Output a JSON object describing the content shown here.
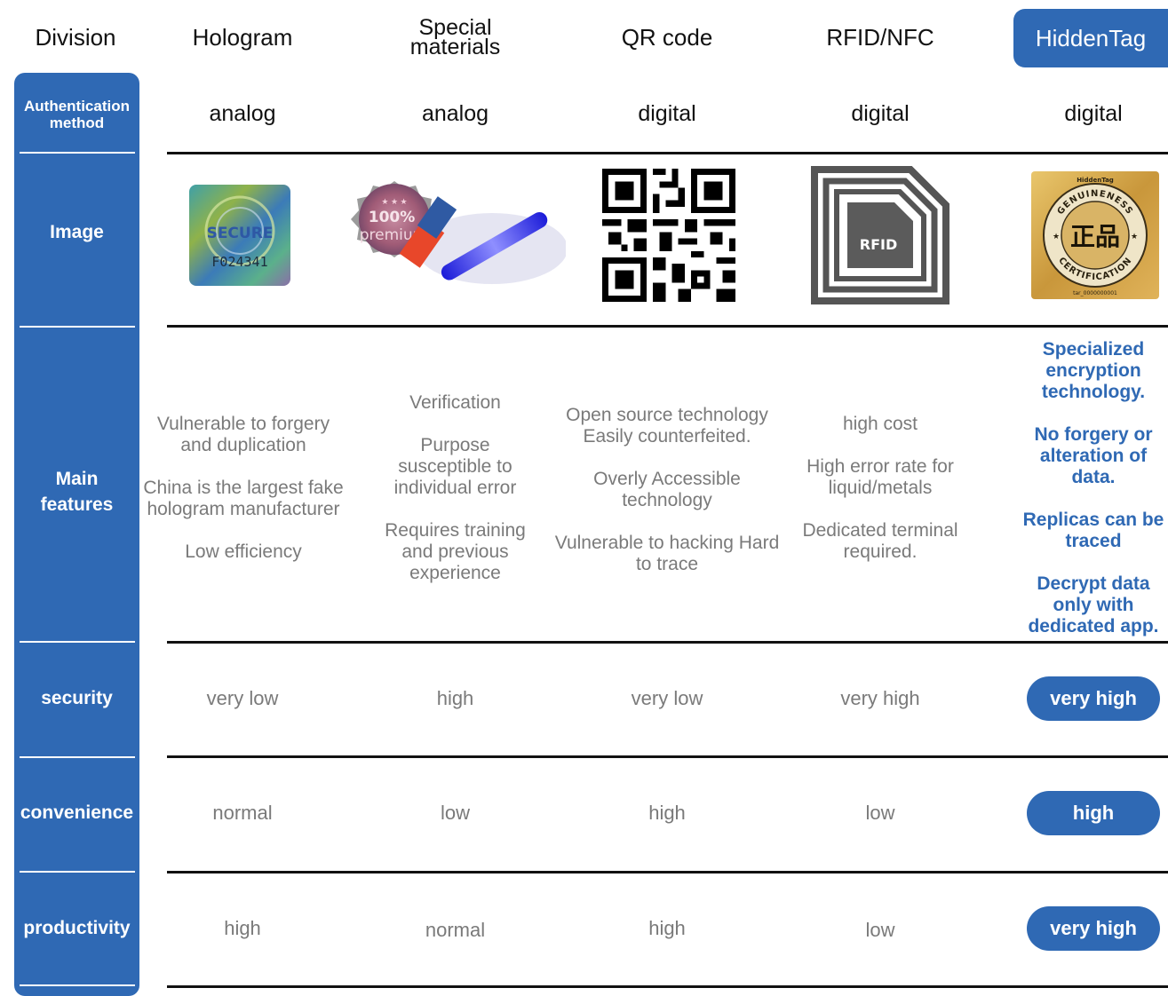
{
  "headers": {
    "division": "Division",
    "hologram": "Hologram",
    "special_line1": "Special",
    "special_line2": "materials",
    "qr": "QR code",
    "rfid": "RFID/NFC",
    "hiddentag": "HiddenTag"
  },
  "rows": {
    "auth_line1": "Authentication",
    "auth_line2": "method",
    "image": "Image",
    "main_line1": "Main",
    "main_line2": "features",
    "security": "security",
    "convenience": "convenience",
    "productivity": "productivity"
  },
  "auth": {
    "hologram": "analog",
    "special": "analog",
    "qr": "digital",
    "rfid": "digital",
    "hiddentag": "digital"
  },
  "images": {
    "hologram_text1": "SECURE",
    "hologram_text2": "F024341",
    "special_text1": "100%",
    "special_text2": "premium",
    "rfid_label": "RFID",
    "hiddentag_brand": "HiddenTag",
    "hiddentag_ring1": "GENUINENESS",
    "hiddentag_ring2": "CERTIFICATION",
    "hiddentag_center": "正品",
    "hiddentag_serial": "tar_0000000001"
  },
  "features": {
    "hologram": [
      "Vulnerable to forgery and duplication",
      "China is the largest fake hologram manufacturer",
      "Low efficiency"
    ],
    "special": [
      "Verification",
      "Purpose susceptible to individual error",
      "Requires training and previous experience"
    ],
    "qr": [
      "Open source technology Easily counterfeited.",
      "Overly Accessible technology",
      "Vulnerable to hacking Hard to trace"
    ],
    "rfid": [
      "high cost",
      "High error rate for liquid/metals",
      "Dedicated terminal required."
    ],
    "hiddentag": [
      "Specialized encryption technology.",
      "No forgery or alteration of data.",
      "Replicas can be traced",
      "Decrypt data only with dedicated app."
    ]
  },
  "security": {
    "hologram": "very low",
    "special": "high",
    "qr": "very low",
    "rfid": "very high",
    "hiddentag": "very high"
  },
  "convenience": {
    "hologram": "normal",
    "special": "low",
    "qr": "high",
    "rfid": "low",
    "hiddentag": "high"
  },
  "productivity": {
    "hologram": "high",
    "special": "normal",
    "qr": "high",
    "rfid": "low",
    "hiddentag": "very high"
  },
  "colors": {
    "accent": "#2f69b4",
    "muted_text": "#7a7a7a"
  }
}
